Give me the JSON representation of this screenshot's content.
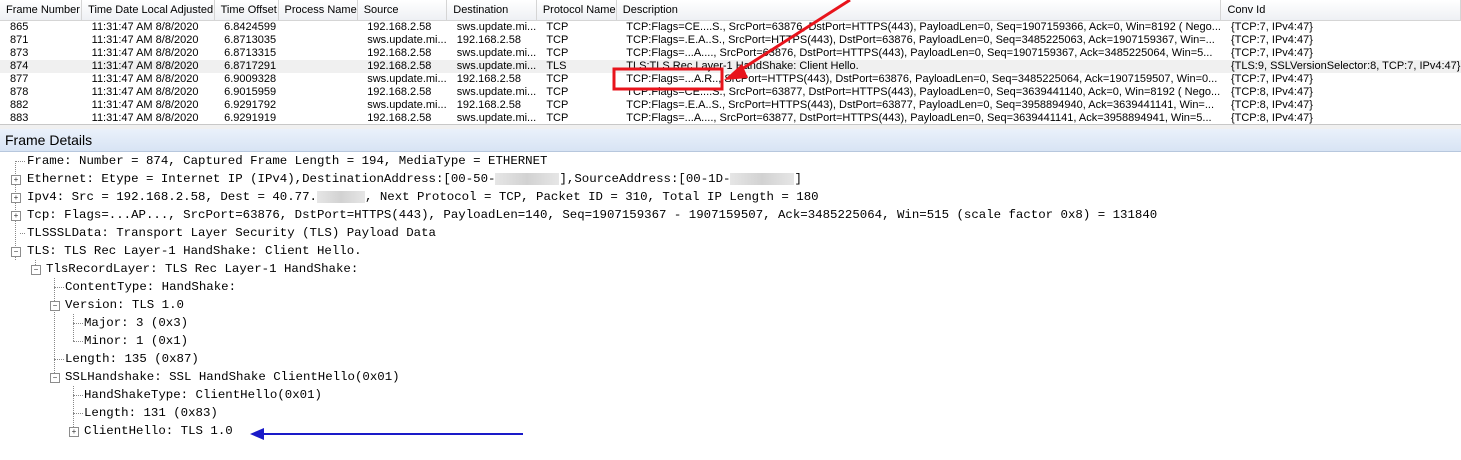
{
  "frame_list": {
    "columns": [
      "Frame Number",
      "Time Date Local Adjusted",
      "Time Offset",
      "Process Name",
      "Source",
      "Destination",
      "Protocol Name",
      "Description",
      "Conv Id"
    ],
    "rows": [
      [
        "865",
        "11:31:47 AM 8/8/2020",
        "6.8424599",
        "",
        "192.168.2.58",
        "sws.update.mi...",
        "TCP",
        "TCP:Flags=CE....S., SrcPort=63876, DstPort=HTTPS(443), PayloadLen=0, Seq=1907159366, Ack=0, Win=8192 ( Nego...",
        "{TCP:7, IPv4:47}"
      ],
      [
        "871",
        "11:31:47 AM 8/8/2020",
        "6.8713035",
        "",
        "sws.update.mi...",
        "192.168.2.58",
        "TCP",
        "TCP:Flags=.E.A..S., SrcPort=HTTPS(443), DstPort=63876, PayloadLen=0, Seq=3485225063, Ack=1907159367, Win=...",
        "{TCP:7, IPv4:47}"
      ],
      [
        "873",
        "11:31:47 AM 8/8/2020",
        "6.8713315",
        "",
        "192.168.2.58",
        "sws.update.mi...",
        "TCP",
        "TCP:Flags=...A...., SrcPort=63876, DstPort=HTTPS(443), PayloadLen=0, Seq=1907159367, Ack=3485225064, Win=5...",
        "{TCP:7, IPv4:47}"
      ],
      [
        "874",
        "11:31:47 AM 8/8/2020",
        "6.8717291",
        "",
        "192.168.2.58",
        "sws.update.mi...",
        "TLS",
        "TLS:TLS Rec Layer-1 HandShake: Client Hello.",
        "{TLS:9, SSLVersionSelector:8, TCP:7, IPv4:47}"
      ],
      [
        "877",
        "11:31:47 AM 8/8/2020",
        "6.9009328",
        "",
        "sws.update.mi...",
        "192.168.2.58",
        "TCP",
        "TCP:Flags=...A.R.., SrcPort=HTTPS(443), DstPort=63876, PayloadLen=0, Seq=3485225064, Ack=1907159507, Win=0...",
        "{TCP:7, IPv4:47}"
      ],
      [
        "878",
        "11:31:47 AM 8/8/2020",
        "6.9015959",
        "",
        "192.168.2.58",
        "sws.update.mi...",
        "TCP",
        "TCP:Flags=CE....S., SrcPort=63877, DstPort=HTTPS(443), PayloadLen=0, Seq=3639441140, Ack=0, Win=8192 ( Nego...",
        "{TCP:8, IPv4:47}"
      ],
      [
        "882",
        "11:31:47 AM 8/8/2020",
        "6.9291792",
        "",
        "sws.update.mi...",
        "192.168.2.58",
        "TCP",
        "TCP:Flags=.E.A..S., SrcPort=HTTPS(443), DstPort=63877, PayloadLen=0, Seq=3958894940, Ack=3639441141, Win=...",
        "{TCP:8, IPv4:47}"
      ],
      [
        "883",
        "11:31:47 AM 8/8/2020",
        "6.9291919",
        "",
        "192.168.2.58",
        "sws.update.mi...",
        "TCP",
        "TCP:Flags=...A...., SrcPort=63877, DstPort=HTTPS(443), PayloadLen=0, Seq=3639441141, Ack=3958894941, Win=5...",
        "{TCP:8, IPv4:47}"
      ]
    ]
  },
  "details": {
    "title": "Frame Details",
    "nodes": [
      "Frame: Number = 874, Captured Frame Length = 194, MediaType = ETHERNET",
      [
        "Ethernet: Etype = Internet IP (IPv4),DestinationAddress:[00-50-",
        "],SourceAddress:[00-1D-",
        "]"
      ],
      [
        "Ipv4: Src = 192.168.2.58, Dest = 40.77.",
        ", Next Protocol = TCP, Packet ID = 310, Total IP Length = 180"
      ],
      "Tcp: Flags=...AP..., SrcPort=63876, DstPort=HTTPS(443), PayloadLen=140, Seq=1907159367 - 1907159507, Ack=3485225064, Win=515 (scale factor 0x8) = 131840",
      "TLSSSLData: Transport Layer Security (TLS) Payload Data",
      "TLS: TLS Rec Layer-1 HandShake: Client Hello.",
      "TlsRecordLayer: TLS Rec Layer-1 HandShake:",
      "ContentType: HandShake:",
      "Version: TLS 1.0",
      "Major: 3 (0x3)",
      "Minor: 1 (0x1)",
      "Length: 135 (0x87)",
      "SSLHandshake: SSL HandShake ClientHello(0x01)",
      "HandShakeType: ClientHello(0x01)",
      "Length: 131 (0x83)",
      "ClientHello: TLS 1.0"
    ]
  },
  "annotations": {
    "red_color": "#e8141c",
    "blue_color": "#1a1ac8",
    "red_box_label": "TCP:Flags=...A.R.."
  }
}
